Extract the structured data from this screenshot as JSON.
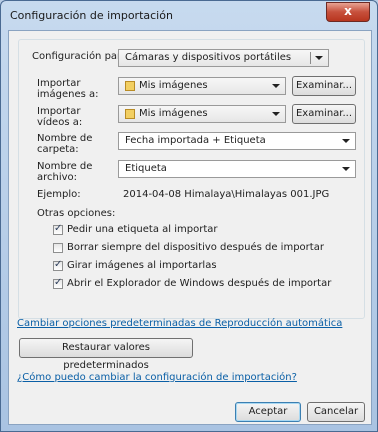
{
  "window": {
    "title": "Configuración de importación",
    "close_glyph": "x"
  },
  "config_para": {
    "label": "Configuración para:",
    "value": "Cámaras y dispositivos portátiles"
  },
  "importar_imagenes": {
    "label_line1": "Importar",
    "label_line2": "imágenes a:",
    "value": "Mis imágenes",
    "button": "Examinar..."
  },
  "importar_videos": {
    "label_line1": "Importar",
    "label_line2": "vídeos a:",
    "value": "Mis imágenes",
    "button": "Examinar..."
  },
  "nombre_carpeta": {
    "label_line1": "Nombre de",
    "label_line2": "carpeta:",
    "value": "Fecha importada + Etiqueta"
  },
  "nombre_archivo": {
    "label_line1": "Nombre de",
    "label_line2": "archivo:",
    "value": "Etiqueta"
  },
  "ejemplo": {
    "label": "Ejemplo:",
    "value": "2014-04-08 Himalaya\\Himalayas 001.JPG"
  },
  "otras_opciones": {
    "label": "Otras opciones:",
    "items": [
      {
        "label": "Pedir una etiqueta al importar",
        "checked": true
      },
      {
        "label": "Borrar siempre del dispositivo después de importar",
        "checked": false
      },
      {
        "label": "Girar imágenes al importarlas",
        "checked": true
      },
      {
        "label": "Abrir el Explorador de Windows después de importar",
        "checked": true
      }
    ]
  },
  "link_autoplay": "Cambiar opciones predeterminadas de Reproducción automática",
  "restore_button": "Restaurar valores predeterminados",
  "link_help": "¿Cómo puedo cambiar la configuración de importación?",
  "footer": {
    "accept": "Aceptar",
    "cancel": "Cancelar"
  },
  "colors": {
    "link": "#0a5fa6",
    "title_bar": "#b9cde5",
    "close": "#c7503c"
  }
}
